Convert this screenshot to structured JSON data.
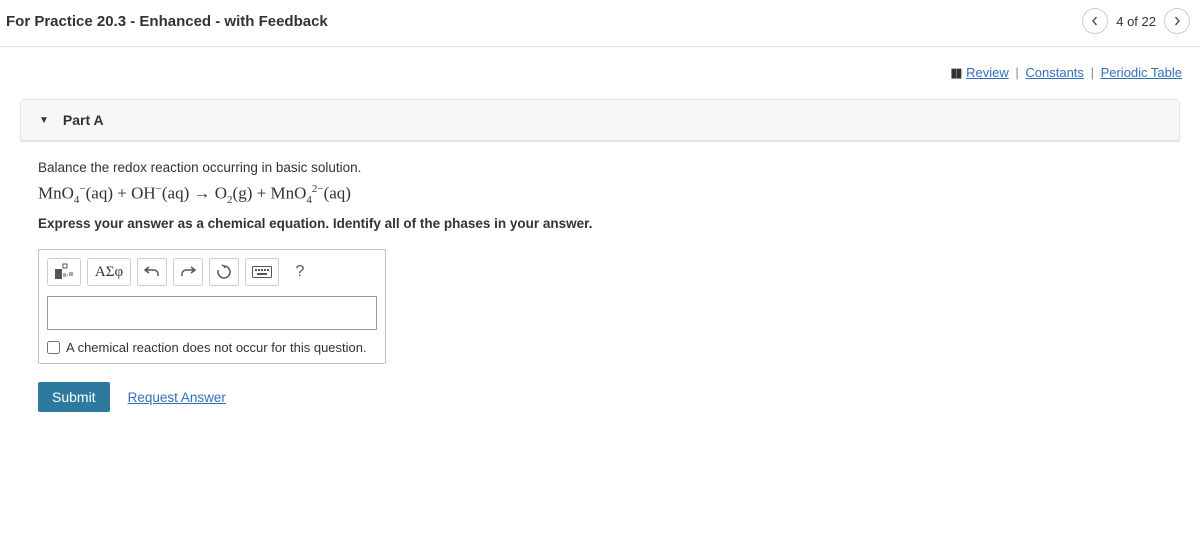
{
  "header": {
    "title": "For Practice 20.3 - Enhanced - with Feedback",
    "progress": "4 of 22"
  },
  "links": {
    "review": "Review",
    "constants": "Constants",
    "periodic": "Periodic Table"
  },
  "part": {
    "label": "Part A",
    "prompt": "Balance the redox reaction occurring in basic solution.",
    "instruction": "Express your answer as a chemical equation. Identify all of the phases in your answer.",
    "equation": {
      "r1": "MnO",
      "r1sub": "4",
      "r1sup": "−",
      "r1phase": "(aq)",
      "plus1": " + ",
      "r2": "OH",
      "r2sup": "−",
      "r2phase": "(aq)",
      "arrow": " → ",
      "p1": "O",
      "p1sub": "2",
      "p1phase": "(g)",
      "plus2": " + ",
      "p2": "MnO",
      "p2sub": "4",
      "p2sup": "2−",
      "p2phase": "(aq)"
    }
  },
  "toolbar": {
    "greek": "ΑΣφ",
    "help": "?"
  },
  "input": {
    "value": ""
  },
  "checkbox": {
    "label": "A chemical reaction does not occur for this question."
  },
  "buttons": {
    "submit": "Submit",
    "request": "Request Answer"
  }
}
